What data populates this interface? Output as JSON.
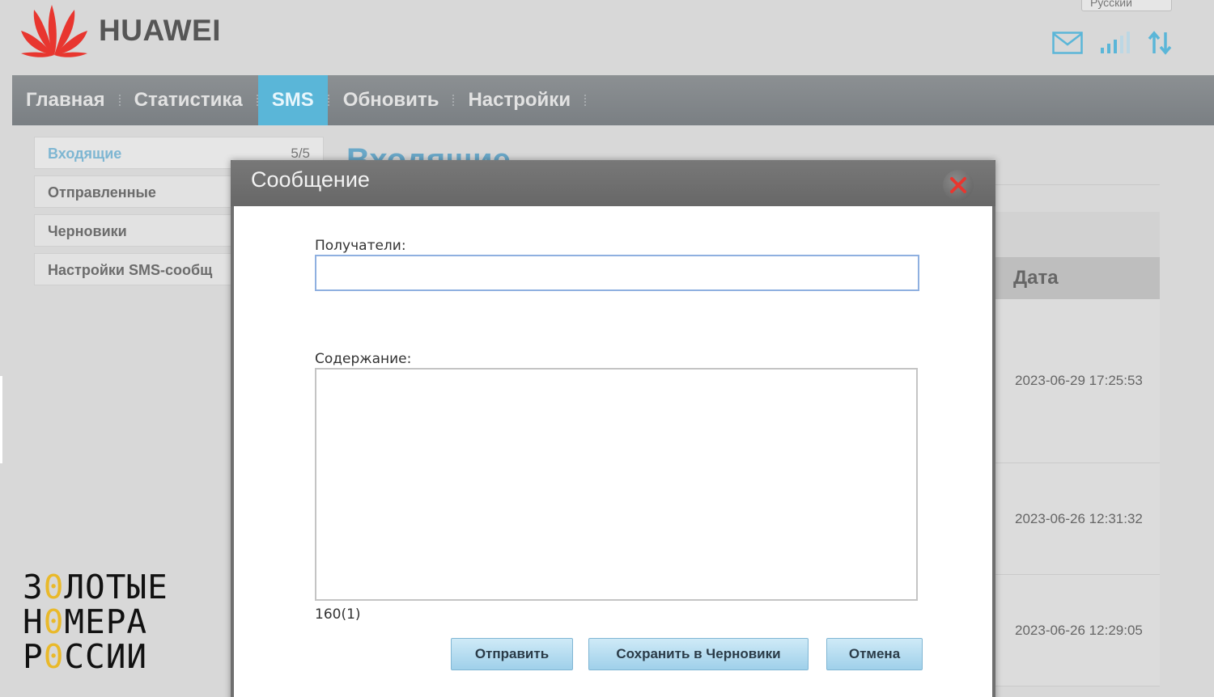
{
  "brand": {
    "name": "HUAWEI"
  },
  "language": {
    "value": "Русский"
  },
  "nav": {
    "items": [
      {
        "label": "Главная",
        "active": false
      },
      {
        "label": "Статистика",
        "active": false
      },
      {
        "label": "SMS",
        "active": true
      },
      {
        "label": "Обновить",
        "active": false
      },
      {
        "label": "Настройки",
        "active": false
      }
    ]
  },
  "sidebar": {
    "items": [
      {
        "label": "Входящие",
        "count": "5/5",
        "active": true
      },
      {
        "label": "Отправленные",
        "count": "",
        "active": false
      },
      {
        "label": "Черновики",
        "count": "",
        "active": false
      },
      {
        "label": "Настройки SMS-сообщ",
        "count": "",
        "active": false
      }
    ]
  },
  "content": {
    "title": "Входящие",
    "date_header": "Дата",
    "rows": [
      {
        "date": "2023-06-29 17:25:53"
      },
      {
        "date": "2023-06-26 12:31:32"
      },
      {
        "date": "2023-06-26 12:29:05"
      }
    ]
  },
  "modal": {
    "title": "Сообщение",
    "recipients_label": "Получатели:",
    "recipients_value": "",
    "content_label": "Содержание:",
    "content_value": "",
    "counter": "160(1)",
    "send_label": "Отправить",
    "save_draft_label": "Сохранить в Черновики",
    "cancel_label": "Отмена"
  },
  "watermark": {
    "line1": [
      "З",
      "0",
      "ЛОТЫЕ"
    ],
    "line2": [
      "Н",
      "0",
      "МЕРА"
    ],
    "line3": [
      "Р",
      "0",
      "ССИИ"
    ]
  },
  "colors": {
    "accent": "#5ab6d8",
    "close_x": "#e8362f",
    "brand_red": "#e8362f",
    "watermark_gold": "#e9b92a"
  },
  "icons": [
    "huawei-logo-icon",
    "mail-icon",
    "signal-icon",
    "transfer-icon",
    "close-icon"
  ]
}
